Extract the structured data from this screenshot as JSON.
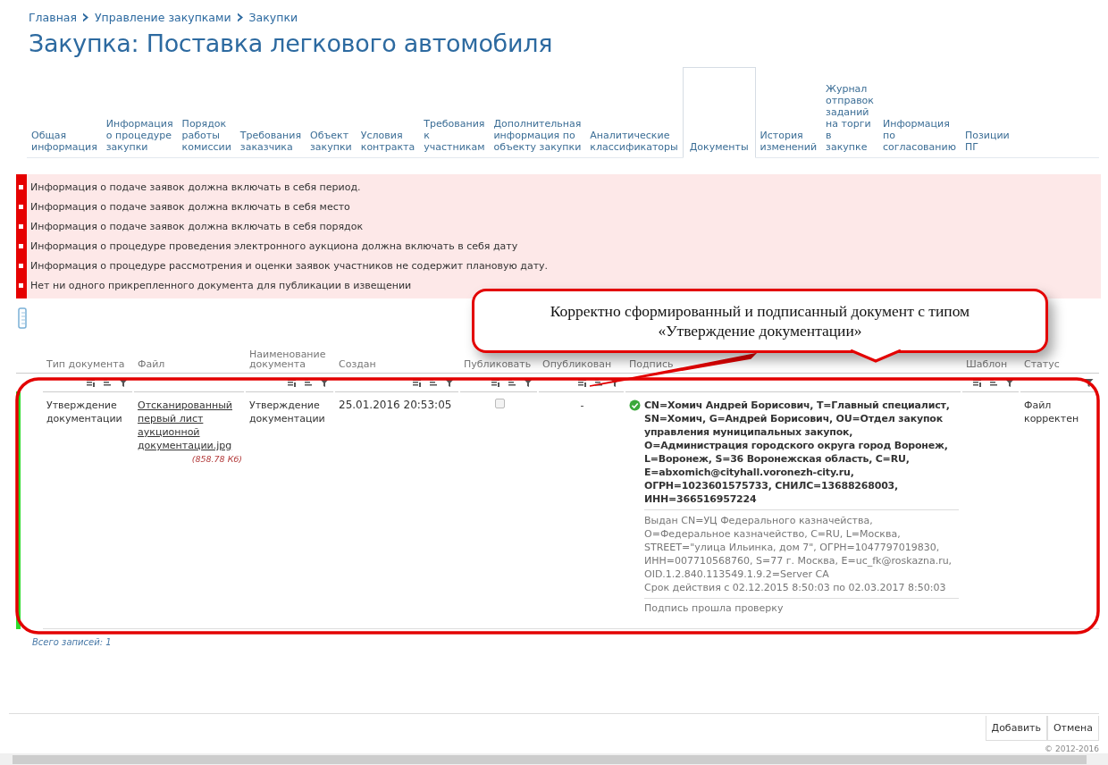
{
  "breadcrumb": [
    "Главная",
    "Управление закупками",
    "Закупки"
  ],
  "title": "Закупка: Поставка легкового автомобиля",
  "tabs": [
    {
      "label": "Общая\nинформация",
      "selected": false
    },
    {
      "label": "Информация\nо процедуре\nзакупки",
      "selected": false
    },
    {
      "label": "Порядок\nработы\nкомиссии",
      "selected": false
    },
    {
      "label": "Требования\nзаказчика",
      "selected": false
    },
    {
      "label": "Объект\nзакупки",
      "selected": false
    },
    {
      "label": "Условия\nконтракта",
      "selected": false
    },
    {
      "label": "Требования\nк\nучастникам",
      "selected": false
    },
    {
      "label": "Дополнительная\nинформация по\nобъекту закупки",
      "selected": false
    },
    {
      "label": "Аналитические\nклассификаторы",
      "selected": false
    },
    {
      "label": "Документы",
      "selected": true
    },
    {
      "label": "История\nизменений",
      "selected": false
    },
    {
      "label": "Журнал\nотправок\nзаданий\nна торги\nв\nзакупке",
      "selected": false
    },
    {
      "label": "Информация\nпо\nсогласованию",
      "selected": false
    },
    {
      "label": "Позиции\nПГ",
      "selected": false
    }
  ],
  "errors": [
    "Информация о подаче заявок должна включать в себя период.",
    "Информация о подаче заявок должна включать в себя место",
    "Информация о подаче заявок должна включать в себя порядок",
    "Информация о процедуре проведения электронного аукциона должна включать в себя дату",
    "Информация о процедуре рассмотрения и оценки заявок участников не содержит плановую дату.",
    "Нет ни одного прикрепленного документа для публикации в извещении"
  ],
  "table": {
    "columns": [
      {
        "label": "Тип документа",
        "kind": "sortable"
      },
      {
        "label": "Файл",
        "kind": "plain"
      },
      {
        "label": "Наименование документа",
        "kind": "sortable"
      },
      {
        "label": "Создан",
        "kind": "sortable"
      },
      {
        "label": "Публиковать",
        "kind": "sortable"
      },
      {
        "label": "Опубликован",
        "kind": "sortable"
      },
      {
        "label": "Подпись",
        "kind": "plain"
      },
      {
        "label": "Шаблон",
        "kind": "sortable"
      },
      {
        "label": "Статус",
        "kind": "filterable"
      }
    ],
    "rows": [
      {
        "valid": true,
        "type": "Утверждение документации",
        "file": "Отсканированный первый лист аукционной документации.jpg",
        "file_size": "(858.78 Кб)",
        "name": "Утверждение документации",
        "created": "25.01.2016 20:53:05",
        "publish": false,
        "published": "-",
        "signature": {
          "verified": true,
          "signer": "CN=Хомич Андрей Борисович, T=Главный специалист, SN=Хомич, G=Андрей Борисович, OU=Отдел закупок управления муниципальных закупок, O=Администрация городского округа город Воронеж, L=Воронеж, S=36 Воронежская область, C=RU, E=abxomich@cityhall.voronezh-city.ru, ОГРН=1023601575733, СНИЛС=13688268003, ИНН=366516957224",
          "issuer": "Выдан CN=УЦ Федерального казначейства, O=Федеральное казначейство, C=RU, L=Москва, STREET=\"улица Ильинка, дом 7\", ОГРН=1047797019830, ИНН=007710568760, S=77 г. Москва, E=uc_fk@roskazna.ru, OID.1.2.840.113549.1.9.2=Server CA",
          "validity": "Срок действия с 02.12.2015 8:50:03 по 02.03.2017 8:50:03",
          "check": "Подпись прошла проверку"
        },
        "status": "Файл корректен"
      }
    ],
    "total": "Всего записей: 1"
  },
  "buttons": [
    "Добавить",
    "Отмена"
  ],
  "copyright": "© 2012-2016",
  "callout": "Корректно сформированный и подписанный документ с типом «Утверждение документации»"
}
